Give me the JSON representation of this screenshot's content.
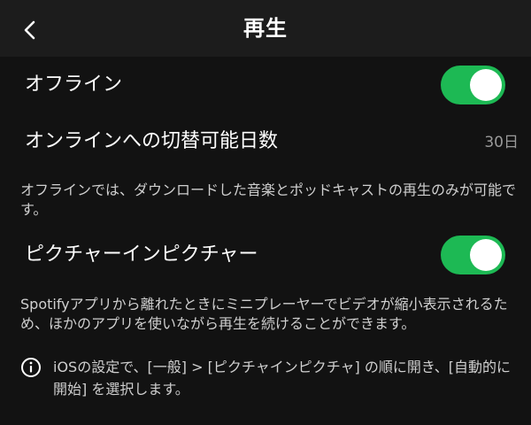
{
  "header": {
    "title": "再生",
    "back_icon": "chevron-left-icon"
  },
  "offline": {
    "label": "オフライン",
    "enabled": true,
    "toggle_color": "#1db954"
  },
  "switch_days": {
    "label": "オンラインへの切替可能日数",
    "value": "30日"
  },
  "offline_description": "オフラインでは、ダウンロードした音楽とポッドキャストの再生のみが可能です。",
  "pip": {
    "label": "ピクチャーインピクチャー",
    "enabled": true,
    "toggle_color": "#1db954"
  },
  "pip_description": "Spotifyアプリから離れたときにミニプレーヤーでビデオが縮小表示されるため、ほかのアプリを使いながら再生を続けることができます。",
  "ios_note": {
    "icon": "info-icon",
    "text": "iOSの設定で、[一般] > [ピクチャインピクチャ] の順に開き、[自動的に開始] を選択します。"
  }
}
